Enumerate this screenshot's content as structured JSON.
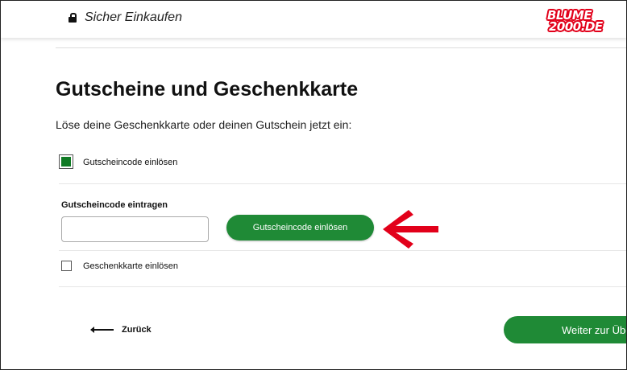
{
  "header": {
    "secure_label": "Sicher Einkaufen",
    "logo_line1": "BLUME",
    "logo_line2": "2000.DE"
  },
  "page": {
    "title": "Gutscheine und Geschenkkarte",
    "subtitle": "Löse deine Geschenkkarte oder deinen Gutschein jetzt ein:"
  },
  "voucher_option": {
    "label": "Gutscheincode einlösen",
    "checked": true,
    "code_label": "Gutscheincode eintragen",
    "code_value": "",
    "code_placeholder": "",
    "redeem_button": "Gutscheincode einlösen"
  },
  "gift_option": {
    "label": "Geschenkkarte einlösen",
    "checked": false
  },
  "footer": {
    "back_label": "Zurück",
    "next_label": "Weiter zur Übe"
  },
  "colors": {
    "accent_green": "#1f8a36",
    "checkbox_green": "#0f7a24",
    "annotation_red": "#e2001a",
    "logo_red": "#e2001a"
  },
  "icons": {
    "lock": "lock-icon",
    "back_arrow": "arrow-left-icon",
    "annotation_arrow": "annotation-arrow-left-icon"
  }
}
